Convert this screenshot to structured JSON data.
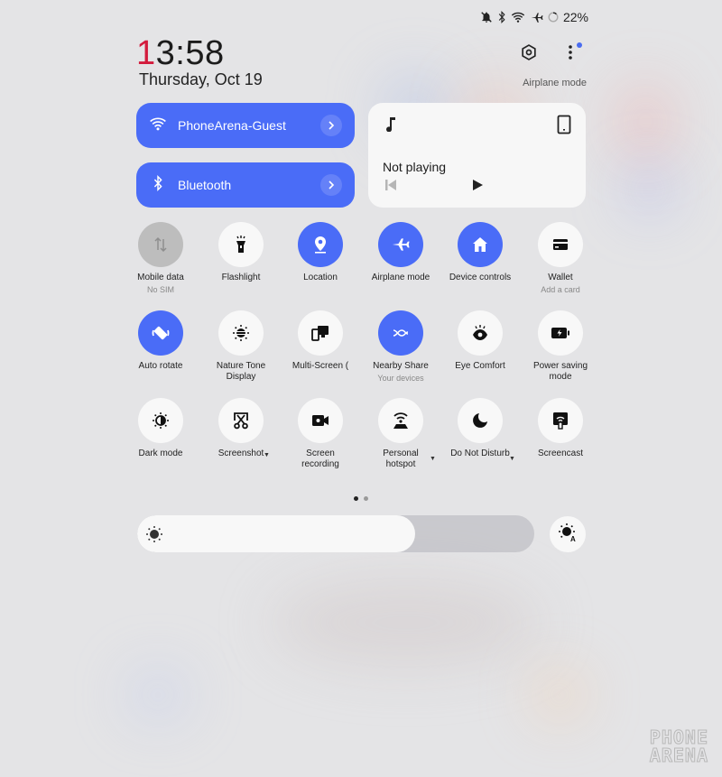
{
  "status_bar": {
    "icons": [
      "mute-icon",
      "bluetooth-icon",
      "wifi-icon",
      "airplane-icon",
      "battery-ring-icon"
    ],
    "battery": "22%"
  },
  "header": {
    "time_accent": "1",
    "time_rest": "3:58",
    "date": "Thursday, Oct 19",
    "mode_label": "Airplane mode",
    "settings_icon": "settings-hexagon-icon",
    "more_icon": "more-vertical-icon"
  },
  "colors": {
    "accent": "#4a6cf7",
    "clock_accent": "#d31b3d",
    "tile_off": "#f8f8f8",
    "tile_disabled": "#bdbdbd",
    "background": "#e4e4e6"
  },
  "wide_tiles": {
    "wifi": {
      "label": "PhoneArena-Guest",
      "icon": "wifi-icon",
      "active": true
    },
    "bluetooth": {
      "label": "Bluetooth",
      "icon": "bluetooth-icon",
      "active": true
    }
  },
  "media": {
    "status": "Not playing",
    "icons": [
      "music-note-icon",
      "phone-device-icon",
      "skip-previous-icon",
      "play-icon"
    ]
  },
  "toggles": [
    {
      "label": "Mobile data",
      "sub": "No SIM",
      "icon": "mobile-data-icon",
      "state": "disabled"
    },
    {
      "label": "Flashlight",
      "sub": "",
      "icon": "flashlight-icon",
      "state": "off"
    },
    {
      "label": "Location",
      "sub": "",
      "icon": "location-icon",
      "state": "on"
    },
    {
      "label": "Airplane mode",
      "sub": "",
      "icon": "airplane-icon",
      "state": "on"
    },
    {
      "label": "Device controls",
      "sub": "",
      "icon": "home-icon",
      "state": "on"
    },
    {
      "label": "Wallet",
      "sub": "Add a card",
      "icon": "wallet-icon",
      "state": "off"
    },
    {
      "label": "Auto rotate",
      "sub": "",
      "icon": "auto-rotate-icon",
      "state": "on"
    },
    {
      "label": "Nature Tone Display",
      "sub": "",
      "icon": "nature-tone-icon",
      "state": "off"
    },
    {
      "label": "Multi-Screen (",
      "sub": "",
      "icon": "multi-screen-icon",
      "state": "off"
    },
    {
      "label": "Nearby Share",
      "sub": "Your devices",
      "icon": "nearby-share-icon",
      "state": "on"
    },
    {
      "label": "Eye Comfort",
      "sub": "",
      "icon": "eye-comfort-icon",
      "state": "off"
    },
    {
      "label": "Power saving mode",
      "sub": "",
      "icon": "power-saving-icon",
      "state": "off"
    },
    {
      "label": "Dark mode",
      "sub": "",
      "icon": "dark-mode-icon",
      "state": "off"
    },
    {
      "label": "Screenshot",
      "sub": "",
      "icon": "screenshot-icon",
      "state": "off",
      "dropdown": true
    },
    {
      "label": "Screen recording",
      "sub": "",
      "icon": "screen-recording-icon",
      "state": "off"
    },
    {
      "label": "Personal hotspot",
      "sub": "",
      "icon": "hotspot-icon",
      "state": "off",
      "dropdown": true
    },
    {
      "label": "Do Not Disturb",
      "sub": "",
      "icon": "do-not-disturb-icon",
      "state": "off",
      "dropdown": true
    },
    {
      "label": "Screencast",
      "sub": "",
      "icon": "screencast-icon",
      "state": "off"
    }
  ],
  "pager": {
    "current": 1,
    "total": 2
  },
  "brightness": {
    "level_percent": 70,
    "auto_icon": "auto-brightness-icon"
  },
  "watermark": {
    "line1": "PHONE",
    "line2": "ARENA"
  }
}
